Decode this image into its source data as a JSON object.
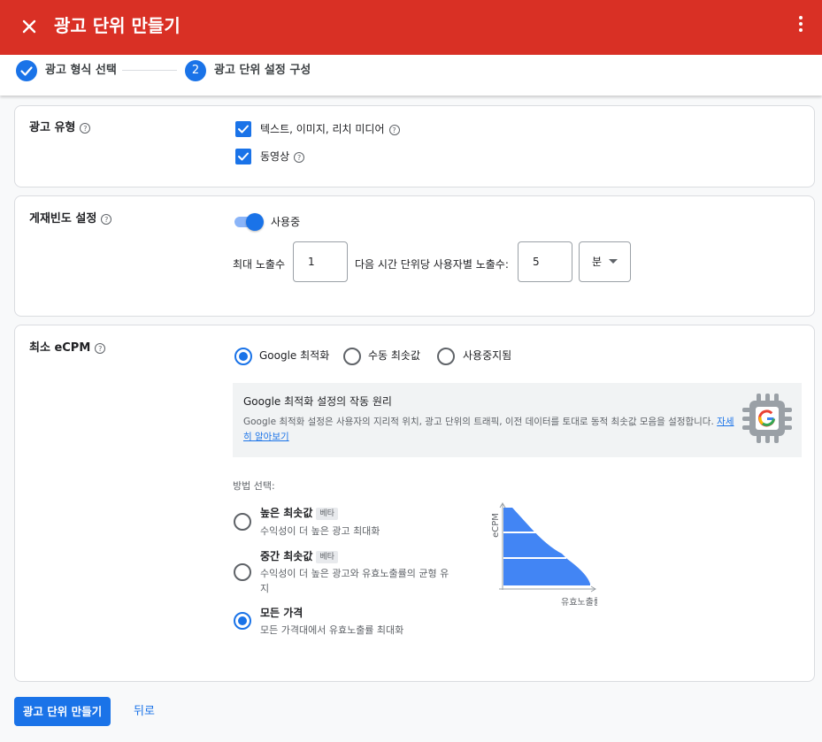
{
  "header": {
    "title": "광고 단위 만들기",
    "close_icon": "close-icon",
    "more_icon": "more-vert-icon"
  },
  "stepper": {
    "steps": [
      {
        "label": "광고 형식 선택",
        "state": "done"
      },
      {
        "number": "2",
        "label": "광고 단위 설정 구성",
        "state": "active"
      }
    ]
  },
  "ad_type": {
    "title": "광고 유형",
    "options": [
      {
        "label": "텍스트, 이미지, 리치 미디어",
        "checked": true,
        "help": true
      },
      {
        "label": "동영상",
        "checked": true,
        "help": true
      }
    ]
  },
  "frequency": {
    "title": "게재빈도 설정",
    "toggle_label": "사용중",
    "toggle_on": true,
    "max_impressions_label": "최대 노출수",
    "max_impressions_value": "1",
    "per_user_label": "다음 시간 단위당 사용자별 노출수:",
    "per_user_value": "5",
    "unit_selected": "분"
  },
  "ecpm": {
    "title": "최소 eCPM",
    "modes": [
      {
        "label": "Google 최적화",
        "selected": true
      },
      {
        "label": "수동 최솟값",
        "selected": false
      },
      {
        "label": "사용중지됨",
        "selected": false
      }
    ],
    "info": {
      "title": "Google 최적화 설정의 작동 원리",
      "desc": "Google 최적화 설정은 사용자의 지리적 위치, 광고 단위의 트래픽, 이전 데이터를 토대로 동적 최솟값 모음을 설정합니다.",
      "link": "자세히 알아보기",
      "icon": "google-chip-icon"
    },
    "method_label": "방법 선택:",
    "methods": [
      {
        "title": "높은 최솟값",
        "badge": "베타",
        "desc": "수익성이 더 높은 광고 최대화",
        "selected": false
      },
      {
        "title": "중간 최솟값",
        "badge": "베타",
        "desc": "수익성이 더 높은 광고와 유효노출률의 균형 유지",
        "selected": false
      },
      {
        "title": "모든 가격",
        "badge": "",
        "desc": "모든 가격대에서 유효노출률 최대화",
        "selected": true
      }
    ],
    "graph": {
      "ylabel": "eCPM",
      "xlabel": "유효노출률"
    }
  },
  "footer": {
    "primary": "광고 단위 만들기",
    "back": "뒤로"
  },
  "colors": {
    "header": "#d93025",
    "accent": "#1a73e8",
    "graph_fill": "#4285f4"
  }
}
